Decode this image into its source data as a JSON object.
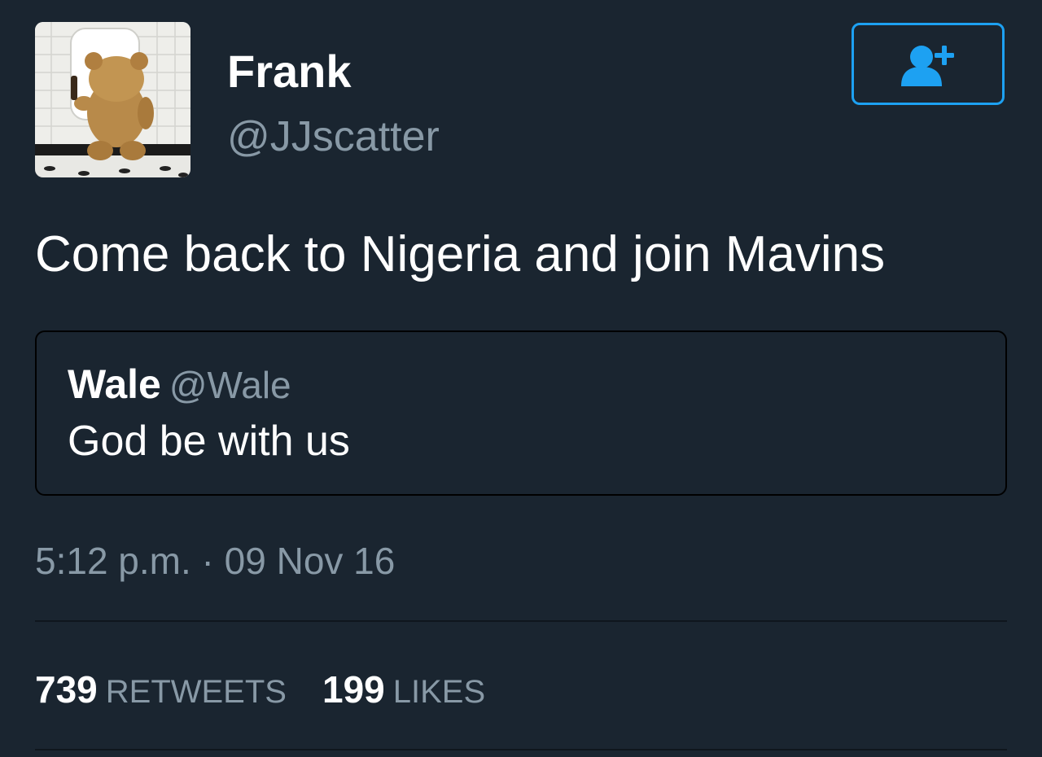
{
  "author": {
    "display_name": "Frank",
    "handle": "@JJscatter",
    "avatar_icon": "teddy-bear-avatar"
  },
  "follow_button": {
    "icon": "add-user-icon",
    "color": "#1da1f2"
  },
  "tweet": {
    "text": "Come back to Nigeria and join Mavins",
    "timestamp": "5:12 p.m. · 09 Nov 16"
  },
  "quoted_tweet": {
    "name": "Wale",
    "handle": "@Wale",
    "text": "God be with us"
  },
  "stats": {
    "retweets_count": "739",
    "retweets_label": "RETWEETS",
    "likes_count": "199",
    "likes_label": "LIKES"
  },
  "colors": {
    "background": "#1a2530",
    "secondary_text": "#8899a6",
    "accent": "#1da1f2"
  }
}
